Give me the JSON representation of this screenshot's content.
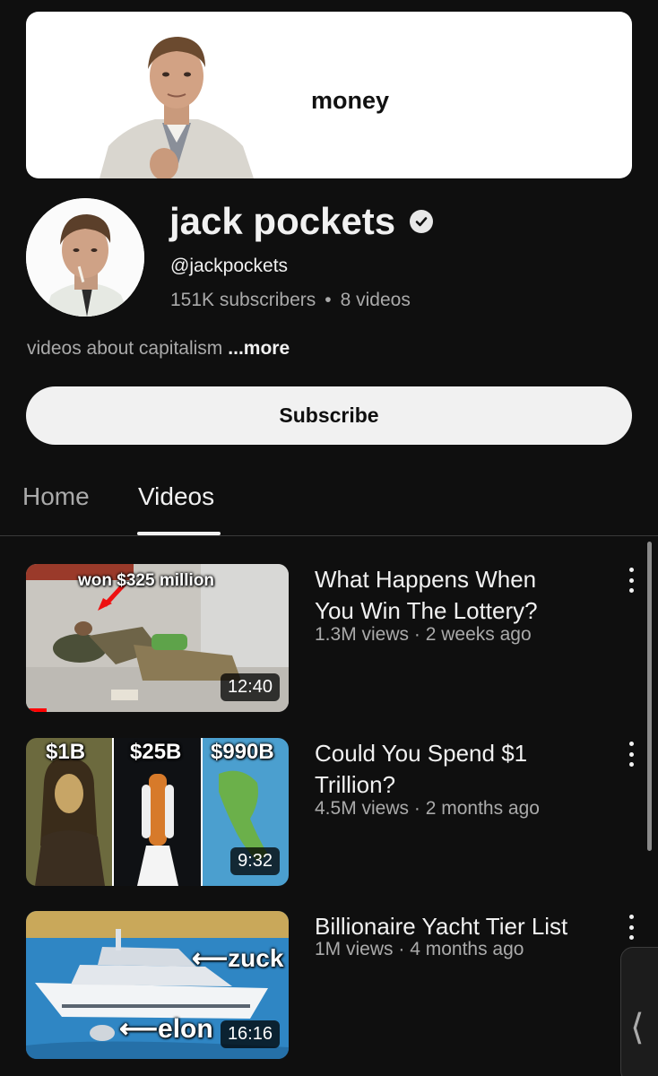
{
  "banner": {
    "title": "money"
  },
  "channel": {
    "name": "jack pockets",
    "handle": "@jackpockets",
    "subscribers": "151K subscribers",
    "separator": "•",
    "videos_count": "8 videos",
    "description": "videos about capitalism",
    "more_label": "...more",
    "subscribe_label": "Subscribe"
  },
  "tabs": [
    {
      "label": "Home",
      "selected": false
    },
    {
      "label": "Videos",
      "selected": true
    }
  ],
  "videos": [
    {
      "title_line1": "What Happens When",
      "title_line2": "You Win The Lottery?",
      "views": "1.3M views",
      "age": "2 weeks ago",
      "duration": "12:40",
      "overlay": "won $325 million",
      "watch_progress": 0.08
    },
    {
      "title_line1": "Could You Spend $1",
      "title_line2": "Trillion?",
      "views": "4.5M views",
      "age": "2 months ago",
      "duration": "9:32",
      "overlay_labels": [
        "$1B",
        "$25B",
        "$990B"
      ]
    },
    {
      "title_line1": "Billionaire Yacht Tier List",
      "views": "1M views",
      "age": "4 months ago",
      "duration": "16:16",
      "overlay_labels": [
        "zuck",
        "elon"
      ]
    }
  ],
  "meta_separator": "·",
  "colors": {
    "background": "#0f0f0f",
    "text_primary": "#f1f1f1",
    "text_secondary": "#aaaaaa",
    "progress_red": "#ff0000"
  },
  "icons": [
    "verified-badge-icon",
    "more-vert-icon",
    "chevron-left-icon"
  ]
}
